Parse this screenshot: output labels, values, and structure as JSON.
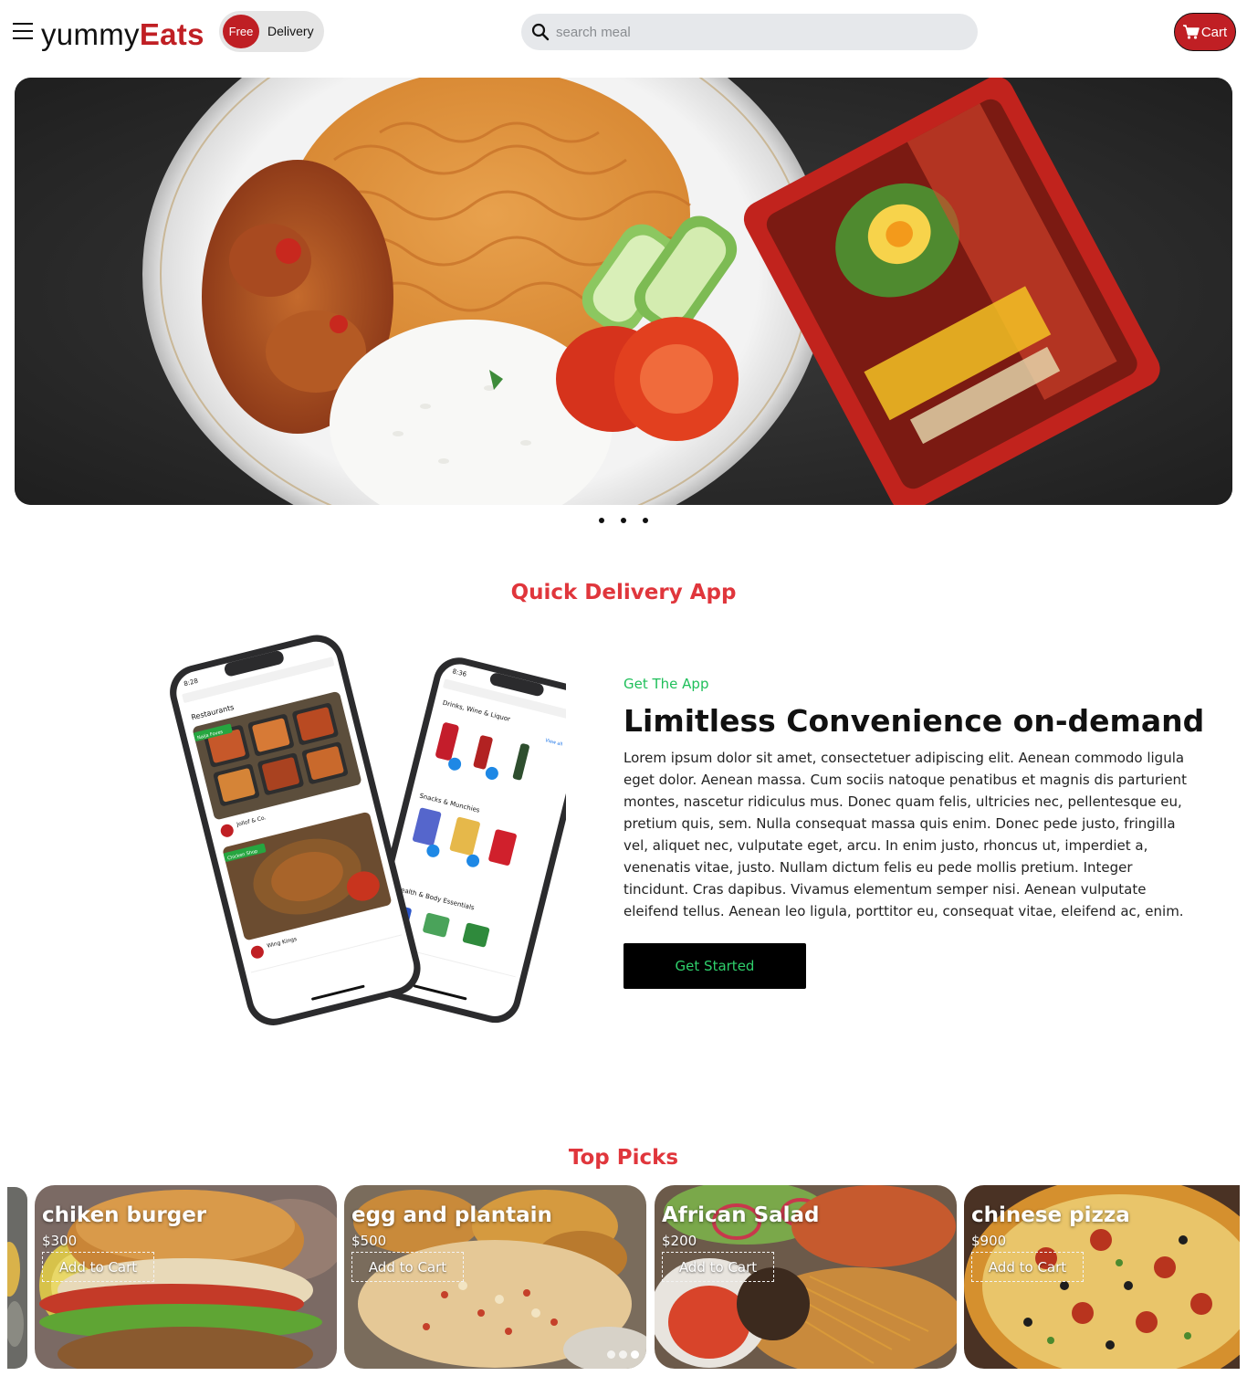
{
  "header": {
    "logo_part1": "yummy",
    "logo_part2": "Eats",
    "free_badge": "Free",
    "delivery_label": "Delivery",
    "search_placeholder": "search meal",
    "cart_label": "Cart",
    "menu_icon": "hamburger-menu-icon",
    "search_icon": "search-icon",
    "cart_icon": "shopping-cart-icon"
  },
  "carousel": {
    "slide_count": 3
  },
  "quick_delivery": {
    "section_title": "Quick Delivery App",
    "kicker": "Get The App",
    "heading": "Limitless Convenience on-demand",
    "body": "Lorem ipsum dolor sit amet, consectetuer adipiscing elit. Aenean commodo ligula eget dolor. Aenean massa. Cum sociis natoque penatibus et magnis dis parturient montes, nascetur ridiculus mus. Donec quam felis, ultricies nec, pellentesque eu, pretium quis, sem. Nulla consequat massa quis enim. Donec pede justo, fringilla vel, aliquet nec, vulputate eget, arcu. In enim justo, rhoncus ut, imperdiet a, venenatis vitae, justo. Nullam dictum felis eu pede mollis pretium. Integer tincidunt. Cras dapibus. Vivamus elementum semper nisi. Aenean vulputate eleifend tellus. Aenean leo ligula, porttitor eu, consequat vitae, eleifend ac, enim.",
    "button_label": "Get Started",
    "phone_left": {
      "time": "8:28",
      "section": "Restaurants",
      "tag1": "Naija Foves",
      "store1": "Jollof & Co.",
      "tag2": "Chicken Shop",
      "store2": "Wing Kings"
    },
    "phone_right": {
      "time": "8:36",
      "section1": "Drinks, Wine & Liquor",
      "section2": "Snacks & Munchies",
      "section3": "Health & Body Essentials",
      "view_all": "View all"
    }
  },
  "top_picks": {
    "section_title": "Top Picks",
    "items": [
      {
        "name": "chiken burger",
        "price": "$300",
        "button": "Add to Cart"
      },
      {
        "name": "egg and plantain",
        "price": "$500",
        "button": "Add to Cart"
      },
      {
        "name": "African Salad",
        "price": "$200",
        "button": "Add to Cart"
      },
      {
        "name": "chinese pizza",
        "price": "$900",
        "button": "Add to Cart"
      }
    ],
    "active_dot": 3
  },
  "colors": {
    "brand_red": "#c01f24",
    "section_title_red": "#e0363c",
    "accent_green": "#1fbf5a"
  }
}
